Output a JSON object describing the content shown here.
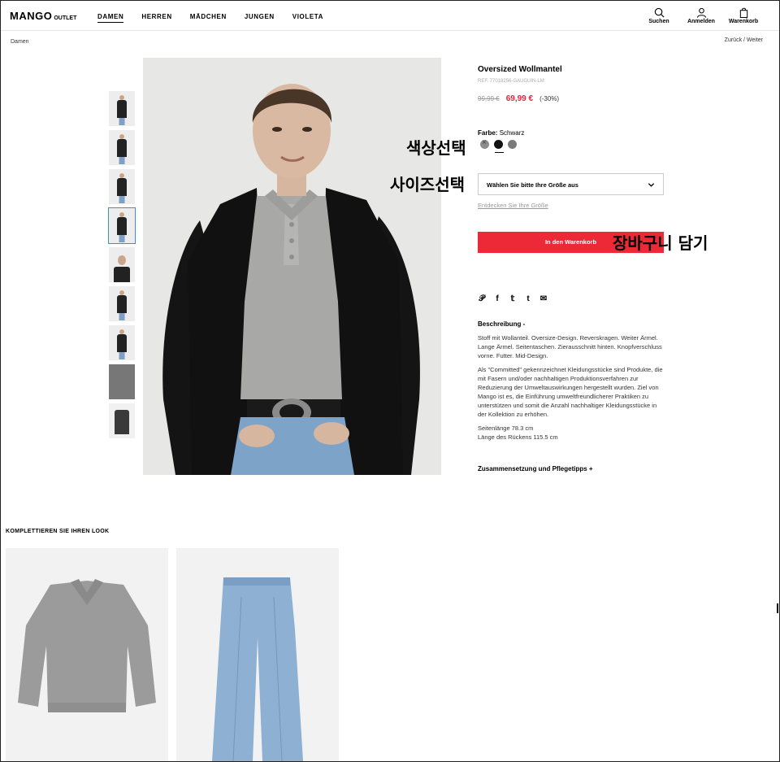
{
  "header": {
    "logo": "MANGO",
    "logo_sub": "OUTLET",
    "nav": [
      "DAMEN",
      "HERREN",
      "MÄDCHEN",
      "JUNGEN",
      "VIOLETA"
    ],
    "search_label": "Suchen",
    "login_label": "Anmelden",
    "cart_label": "Warenkorb"
  },
  "breadcrumb": "Damen",
  "pager": "Zurück / Weiter",
  "product": {
    "name": "Oversized Wollmantel",
    "ref": "REF. 77018256-GAUGUIN-LM",
    "old_price": "99,99 €",
    "new_price": "69,99 €",
    "discount": "(-30%)",
    "color_label": "Farbe:",
    "color_value": "Schwarz",
    "size_placeholder": "Wählen Sie bitte Ihre Größe aus",
    "size_link": "Entdecken Sie Ihre Größe",
    "cart_button": "In den Warenkorb",
    "share_icons": [
      "pinterest-icon",
      "facebook-icon",
      "twitter-icon",
      "tumblr-icon",
      "mail-icon"
    ],
    "description_title": "Beschreibung -",
    "description_1": "Stoff mit Wollanteil. Oversize-Design. Reverskragen. Weiter Ärmel. Lange Ärmel. Seitentaschen. Zierausschnitt hinten. Knopfverschluss vorne. Futter. Mid-Design.",
    "description_2": "Als \"Committed\" gekennzeichnet Kleidungsstücke sind Produkte, die mit Fasern und/oder nachhaltigen Produktionsverfahren zur Reduzierung der Umweltauswirkungen hergestellt wurden. Ziel von Mango ist es, die Einführung umweltfreundlicherer Praktiken zu unterstützen und somit die Anzahl nachhaltiger Kleidungsstücke in der Kollektion zu erhöhen.",
    "length_1": "Seitenlänge 78.3 cm",
    "length_2": "Länge des Rückens 115.5 cm",
    "composition_title": "Zusammensetzung und Pflegetipps +"
  },
  "annotations": {
    "color": "색상선택",
    "size": "사이즈선택",
    "cart": "장바구니 담기"
  },
  "look": {
    "title": "KOMPLETTIEREN SIE IHREN LOOK"
  },
  "colors": {
    "accent": "#ee2937",
    "sale": "#e0263a"
  }
}
